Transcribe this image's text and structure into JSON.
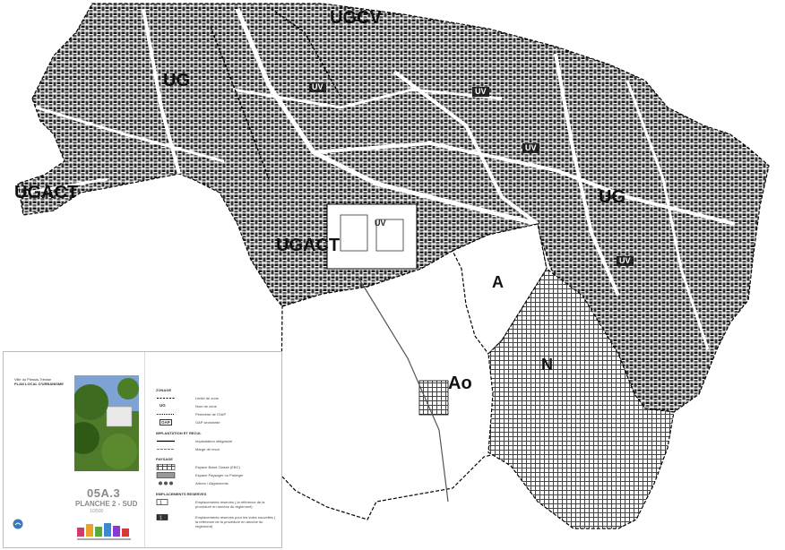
{
  "map": {
    "zones": [
      {
        "id": "ugcv",
        "label": "UGCV"
      },
      {
        "id": "ug-nw",
        "label": "UG"
      },
      {
        "id": "ug-e",
        "label": "UG"
      },
      {
        "id": "ugact-w",
        "label": "UGACT"
      },
      {
        "id": "ugact-c",
        "label": "UGACT"
      },
      {
        "id": "a",
        "label": "A"
      },
      {
        "id": "ao",
        "label": "Ao"
      },
      {
        "id": "n",
        "label": "N"
      },
      {
        "id": "uv-c",
        "label": "UV"
      },
      {
        "id": "uv-n",
        "label": "UV"
      },
      {
        "id": "uv-ne",
        "label": "UV"
      },
      {
        "id": "uv-e1",
        "label": "UV"
      },
      {
        "id": "uv-e2",
        "label": "UV"
      }
    ],
    "colors": {
      "built": "#111111",
      "hatched": "#555555",
      "streets": "#ffffff",
      "background": "#ffffff"
    }
  },
  "cartouche": {
    "town": "Ville du Plessis-Trévise",
    "plan_title": "PLAN LOCAL D'URBANISME",
    "sheet_code": "05A.3",
    "sheet_name": "PLANCHE 2 - SUD",
    "scale": "1/3500",
    "legend": {
      "zonage_title": "ZONAGE",
      "zonage_items": [
        {
          "code": "",
          "text": "Limite de zone"
        },
        {
          "code": "UG",
          "text": "Nom de zone"
        },
        {
          "code": "",
          "text": "Périmètre de l'OAP"
        },
        {
          "code": "OAP",
          "text": "OAP sectorielle"
        }
      ],
      "implantation_title": "IMPLANTATION ET RECUL",
      "implantation_items": [
        {
          "text": "Implantation obligatoire"
        },
        {
          "text": "Marge de recul"
        }
      ],
      "paysage_title": "PAYSAGE",
      "paysage_items": [
        {
          "text": "Espace Boisé Classé (EBC)"
        },
        {
          "text": "Espace Paysager ou Protéger"
        },
        {
          "text": "Arbres / Alignements"
        }
      ],
      "er_title": "EMPLACEMENTS RESERVES",
      "er_items": [
        {
          "text": "Emplacements réservés ( la référence de la procédure en annexe du règlement)"
        },
        {
          "text": "Emplacements réservés pour les voies nouvelles ( la référence de la procédure en annexe du règlement)"
        }
      ]
    }
  }
}
